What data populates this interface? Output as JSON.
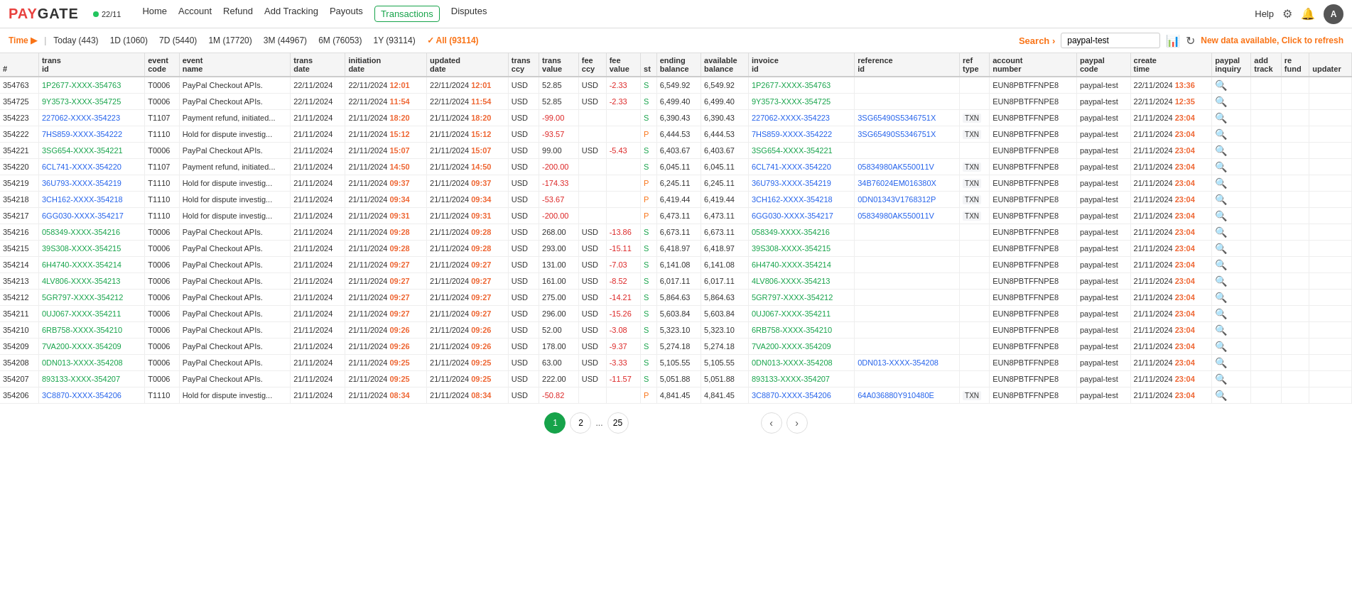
{
  "logo": {
    "text_pay": "PAY",
    "text_gate": "GATE",
    "online_status": "22/11"
  },
  "nav": {
    "links": [
      "Home",
      "Account",
      "Refund",
      "Add Tracking",
      "Payouts",
      "Transactions",
      "Disputes"
    ],
    "active": "Transactions",
    "right": [
      "Help"
    ]
  },
  "filter_bar": {
    "time_label": "Time",
    "arrow": "▶",
    "items": [
      {
        "label": "Today (443)"
      },
      {
        "label": "1D (1060)"
      },
      {
        "label": "7D (5440)"
      },
      {
        "label": "1M (17720)"
      },
      {
        "label": "3M (44967)"
      },
      {
        "label": "6M (76053)"
      },
      {
        "label": "1Y (93114)"
      },
      {
        "label": "✓ All (93114)",
        "active": true
      }
    ],
    "search_label": "Search",
    "search_arrow": "›",
    "search_value": "paypal-test",
    "new_data_msg": "New data available, Click to refresh"
  },
  "table": {
    "columns": [
      {
        "key": "#",
        "label": "#"
      },
      {
        "key": "trans_id",
        "label": "trans\nid"
      },
      {
        "key": "event_code",
        "label": "event\ncode"
      },
      {
        "key": "event_name",
        "label": "event\nname"
      },
      {
        "key": "trans_date",
        "label": "trans\ndate"
      },
      {
        "key": "initiation_date",
        "label": "initiation\ndate"
      },
      {
        "key": "updated_date",
        "label": "updated\ndate"
      },
      {
        "key": "trans_ccy",
        "label": "trans\nccy"
      },
      {
        "key": "trans_value",
        "label": "trans\nvalue"
      },
      {
        "key": "fee_ccy",
        "label": "fee\nccy"
      },
      {
        "key": "fee_value",
        "label": "fee\nvalue"
      },
      {
        "key": "st",
        "label": "st"
      },
      {
        "key": "ending_balance",
        "label": "ending\nbalance"
      },
      {
        "key": "available_balance",
        "label": "available\nbalance"
      },
      {
        "key": "invoice_id",
        "label": "invoice\nid"
      },
      {
        "key": "reference_id",
        "label": "reference\nid"
      },
      {
        "key": "ref_type",
        "label": "ref\ntype"
      },
      {
        "key": "account_number",
        "label": "account\nnumber"
      },
      {
        "key": "paypal_code",
        "label": "paypal\ncode"
      },
      {
        "key": "create_time",
        "label": "create\ntime"
      },
      {
        "key": "paypal_inquiry",
        "label": "paypal\ninquiry"
      },
      {
        "key": "add_track",
        "label": "add\ntrack"
      },
      {
        "key": "re_fund",
        "label": "re\nfund"
      },
      {
        "key": "updater",
        "label": "updater"
      }
    ],
    "rows": [
      {
        "num": "354763",
        "trans_id": "1P2677-XXXX-354763",
        "event_code": "T0006",
        "event_name": "PayPal Checkout APIs.",
        "trans_date": "22/11/2024",
        "initiation_date": "22/11/2024",
        "initiation_time": "12:01",
        "updated_date": "22/11/2024",
        "updated_time": "12:01",
        "trans_ccy": "USD",
        "trans_value": "52.85",
        "fee_ccy": "USD",
        "fee_value": "-2.33",
        "st": "S",
        "ending_balance": "6,549.92",
        "available_balance": "6,549.92",
        "invoice_id": "1P2677-XXXX-354763",
        "reference_id": "",
        "ref_type": "",
        "account_number": "EUN8PBTFFNPE8",
        "paypal_code": "paypal-test",
        "create_date": "22/11/2024",
        "create_time": "13:36"
      },
      {
        "num": "354725",
        "trans_id": "9Y3573-XXXX-354725",
        "event_code": "T0006",
        "event_name": "PayPal Checkout APIs.",
        "trans_date": "22/11/2024",
        "initiation_date": "22/11/2024",
        "initiation_time": "11:54",
        "updated_date": "22/11/2024",
        "updated_time": "11:54",
        "trans_ccy": "USD",
        "trans_value": "52.85",
        "fee_ccy": "USD",
        "fee_value": "-2.33",
        "st": "S",
        "ending_balance": "6,499.40",
        "available_balance": "6,499.40",
        "invoice_id": "9Y3573-XXXX-354725",
        "reference_id": "",
        "ref_type": "",
        "account_number": "EUN8PBTFFNPE8",
        "paypal_code": "paypal-test",
        "create_date": "22/11/2024",
        "create_time": "12:35"
      },
      {
        "num": "354223",
        "trans_id": "227062-XXXX-354223",
        "event_code": "T1107",
        "event_name": "Payment refund, initiated...",
        "trans_date": "21/11/2024",
        "initiation_date": "21/11/2024",
        "initiation_time": "18:20",
        "updated_date": "21/11/2024",
        "updated_time": "18:20",
        "trans_ccy": "USD",
        "trans_value": "-99.00",
        "fee_ccy": "",
        "fee_value": "",
        "st": "S",
        "ending_balance": "6,390.43",
        "available_balance": "6,390.43",
        "invoice_id": "227062-XXXX-354223",
        "reference_id": "3SG65490S5346751X",
        "ref_type": "TXN",
        "account_number": "EUN8PBTFFNPE8",
        "paypal_code": "paypal-test",
        "create_date": "21/11/2024",
        "create_time": "23:04"
      },
      {
        "num": "354222",
        "trans_id": "7HS859-XXXX-354222",
        "event_code": "T1110",
        "event_name": "Hold for dispute investig...",
        "trans_date": "21/11/2024",
        "initiation_date": "21/11/2024",
        "initiation_time": "15:12",
        "updated_date": "21/11/2024",
        "updated_time": "15:12",
        "trans_ccy": "USD",
        "trans_value": "-93.57",
        "fee_ccy": "",
        "fee_value": "",
        "st": "P",
        "ending_balance": "6,444.53",
        "available_balance": "6,444.53",
        "invoice_id": "7HS859-XXXX-354222",
        "reference_id": "3SG65490S5346751X",
        "ref_type": "TXN",
        "account_number": "EUN8PBTFFNPE8",
        "paypal_code": "paypal-test",
        "create_date": "21/11/2024",
        "create_time": "23:04"
      },
      {
        "num": "354221",
        "trans_id": "3SG654-XXXX-354221",
        "event_code": "T0006",
        "event_name": "PayPal Checkout APIs.",
        "trans_date": "21/11/2024",
        "initiation_date": "21/11/2024",
        "initiation_time": "15:07",
        "updated_date": "21/11/2024",
        "updated_time": "15:07",
        "trans_ccy": "USD",
        "trans_value": "99.00",
        "fee_ccy": "USD",
        "fee_value": "-5.43",
        "st": "S",
        "ending_balance": "6,403.67",
        "available_balance": "6,403.67",
        "invoice_id": "3SG654-XXXX-354221",
        "reference_id": "",
        "ref_type": "",
        "account_number": "EUN8PBTFFNPE8",
        "paypal_code": "paypal-test",
        "create_date": "21/11/2024",
        "create_time": "23:04"
      },
      {
        "num": "354220",
        "trans_id": "6CL741-XXXX-354220",
        "event_code": "T1107",
        "event_name": "Payment refund, initiated...",
        "trans_date": "21/11/2024",
        "initiation_date": "21/11/2024",
        "initiation_time": "14:50",
        "updated_date": "21/11/2024",
        "updated_time": "14:50",
        "trans_ccy": "USD",
        "trans_value": "-200.00",
        "fee_ccy": "",
        "fee_value": "",
        "st": "S",
        "ending_balance": "6,045.11",
        "available_balance": "6,045.11",
        "invoice_id": "6CL741-XXXX-354220",
        "reference_id": "05834980AK550011V",
        "ref_type": "TXN",
        "account_number": "EUN8PBTFFNPE8",
        "paypal_code": "paypal-test",
        "create_date": "21/11/2024",
        "create_time": "23:04"
      },
      {
        "num": "354219",
        "trans_id": "36U793-XXXX-354219",
        "event_code": "T1110",
        "event_name": "Hold for dispute investig...",
        "trans_date": "21/11/2024",
        "initiation_date": "21/11/2024",
        "initiation_time": "09:37",
        "updated_date": "21/11/2024",
        "updated_time": "09:37",
        "trans_ccy": "USD",
        "trans_value": "-174.33",
        "fee_ccy": "",
        "fee_value": "",
        "st": "P",
        "ending_balance": "6,245.11",
        "available_balance": "6,245.11",
        "invoice_id": "36U793-XXXX-354219",
        "reference_id": "34B76024EM016380X",
        "ref_type": "TXN",
        "account_number": "EUN8PBTFFNPE8",
        "paypal_code": "paypal-test",
        "create_date": "21/11/2024",
        "create_time": "23:04"
      },
      {
        "num": "354218",
        "trans_id": "3CH162-XXXX-354218",
        "event_code": "T1110",
        "event_name": "Hold for dispute investig...",
        "trans_date": "21/11/2024",
        "initiation_date": "21/11/2024",
        "initiation_time": "09:34",
        "updated_date": "21/11/2024",
        "updated_time": "09:34",
        "trans_ccy": "USD",
        "trans_value": "-53.67",
        "fee_ccy": "",
        "fee_value": "",
        "st": "P",
        "ending_balance": "6,419.44",
        "available_balance": "6,419.44",
        "invoice_id": "3CH162-XXXX-354218",
        "reference_id": "0DN01343V1768312P",
        "ref_type": "TXN",
        "account_number": "EUN8PBTFFNPE8",
        "paypal_code": "paypal-test",
        "create_date": "21/11/2024",
        "create_time": "23:04"
      },
      {
        "num": "354217",
        "trans_id": "6GG030-XXXX-354217",
        "event_code": "T1110",
        "event_name": "Hold for dispute investig...",
        "trans_date": "21/11/2024",
        "initiation_date": "21/11/2024",
        "initiation_time": "09:31",
        "updated_date": "21/11/2024",
        "updated_time": "09:31",
        "trans_ccy": "USD",
        "trans_value": "-200.00",
        "fee_ccy": "",
        "fee_value": "",
        "st": "P",
        "ending_balance": "6,473.11",
        "available_balance": "6,473.11",
        "invoice_id": "6GG030-XXXX-354217",
        "reference_id": "05834980AK550011V",
        "ref_type": "TXN",
        "account_number": "EUN8PBTFFNPE8",
        "paypal_code": "paypal-test",
        "create_date": "21/11/2024",
        "create_time": "23:04"
      },
      {
        "num": "354216",
        "trans_id": "058349-XXXX-354216",
        "event_code": "T0006",
        "event_name": "PayPal Checkout APIs.",
        "trans_date": "21/11/2024",
        "initiation_date": "21/11/2024",
        "initiation_time": "09:28",
        "updated_date": "21/11/2024",
        "updated_time": "09:28",
        "trans_ccy": "USD",
        "trans_value": "268.00",
        "fee_ccy": "USD",
        "fee_value": "-13.86",
        "st": "S",
        "ending_balance": "6,673.11",
        "available_balance": "6,673.11",
        "invoice_id": "058349-XXXX-354216",
        "reference_id": "",
        "ref_type": "",
        "account_number": "EUN8PBTFFNPE8",
        "paypal_code": "paypal-test",
        "create_date": "21/11/2024",
        "create_time": "23:04"
      },
      {
        "num": "354215",
        "trans_id": "39S308-XXXX-354215",
        "event_code": "T0006",
        "event_name": "PayPal Checkout APIs.",
        "trans_date": "21/11/2024",
        "initiation_date": "21/11/2024",
        "initiation_time": "09:28",
        "updated_date": "21/11/2024",
        "updated_time": "09:28",
        "trans_ccy": "USD",
        "trans_value": "293.00",
        "fee_ccy": "USD",
        "fee_value": "-15.11",
        "st": "S",
        "ending_balance": "6,418.97",
        "available_balance": "6,418.97",
        "invoice_id": "39S308-XXXX-354215",
        "reference_id": "",
        "ref_type": "",
        "account_number": "EUN8PBTFFNPE8",
        "paypal_code": "paypal-test",
        "create_date": "21/11/2024",
        "create_time": "23:04"
      },
      {
        "num": "354214",
        "trans_id": "6H4740-XXXX-354214",
        "event_code": "T0006",
        "event_name": "PayPal Checkout APIs.",
        "trans_date": "21/11/2024",
        "initiation_date": "21/11/2024",
        "initiation_time": "09:27",
        "updated_date": "21/11/2024",
        "updated_time": "09:27",
        "trans_ccy": "USD",
        "trans_value": "131.00",
        "fee_ccy": "USD",
        "fee_value": "-7.03",
        "st": "S",
        "ending_balance": "6,141.08",
        "available_balance": "6,141.08",
        "invoice_id": "6H4740-XXXX-354214",
        "reference_id": "",
        "ref_type": "",
        "account_number": "EUN8PBTFFNPE8",
        "paypal_code": "paypal-test",
        "create_date": "21/11/2024",
        "create_time": "23:04"
      },
      {
        "num": "354213",
        "trans_id": "4LV806-XXXX-354213",
        "event_code": "T0006",
        "event_name": "PayPal Checkout APIs.",
        "trans_date": "21/11/2024",
        "initiation_date": "21/11/2024",
        "initiation_time": "09:27",
        "updated_date": "21/11/2024",
        "updated_time": "09:27",
        "trans_ccy": "USD",
        "trans_value": "161.00",
        "fee_ccy": "USD",
        "fee_value": "-8.52",
        "st": "S",
        "ending_balance": "6,017.11",
        "available_balance": "6,017.11",
        "invoice_id": "4LV806-XXXX-354213",
        "reference_id": "",
        "ref_type": "",
        "account_number": "EUN8PBTFFNPE8",
        "paypal_code": "paypal-test",
        "create_date": "21/11/2024",
        "create_time": "23:04"
      },
      {
        "num": "354212",
        "trans_id": "5GR797-XXXX-354212",
        "event_code": "T0006",
        "event_name": "PayPal Checkout APIs.",
        "trans_date": "21/11/2024",
        "initiation_date": "21/11/2024",
        "initiation_time": "09:27",
        "updated_date": "21/11/2024",
        "updated_time": "09:27",
        "trans_ccy": "USD",
        "trans_value": "275.00",
        "fee_ccy": "USD",
        "fee_value": "-14.21",
        "st": "S",
        "ending_balance": "5,864.63",
        "available_balance": "5,864.63",
        "invoice_id": "5GR797-XXXX-354212",
        "reference_id": "",
        "ref_type": "",
        "account_number": "EUN8PBTFFNPE8",
        "paypal_code": "paypal-test",
        "create_date": "21/11/2024",
        "create_time": "23:04"
      },
      {
        "num": "354211",
        "trans_id": "0UJ067-XXXX-354211",
        "event_code": "T0006",
        "event_name": "PayPal Checkout APIs.",
        "trans_date": "21/11/2024",
        "initiation_date": "21/11/2024",
        "initiation_time": "09:27",
        "updated_date": "21/11/2024",
        "updated_time": "09:27",
        "trans_ccy": "USD",
        "trans_value": "296.00",
        "fee_ccy": "USD",
        "fee_value": "-15.26",
        "st": "S",
        "ending_balance": "5,603.84",
        "available_balance": "5,603.84",
        "invoice_id": "0UJ067-XXXX-354211",
        "reference_id": "",
        "ref_type": "",
        "account_number": "EUN8PBTFFNPE8",
        "paypal_code": "paypal-test",
        "create_date": "21/11/2024",
        "create_time": "23:04"
      },
      {
        "num": "354210",
        "trans_id": "6RB758-XXXX-354210",
        "event_code": "T0006",
        "event_name": "PayPal Checkout APIs.",
        "trans_date": "21/11/2024",
        "initiation_date": "21/11/2024",
        "initiation_time": "09:26",
        "updated_date": "21/11/2024",
        "updated_time": "09:26",
        "trans_ccy": "USD",
        "trans_value": "52.00",
        "fee_ccy": "USD",
        "fee_value": "-3.08",
        "st": "S",
        "ending_balance": "5,323.10",
        "available_balance": "5,323.10",
        "invoice_id": "6RB758-XXXX-354210",
        "reference_id": "",
        "ref_type": "",
        "account_number": "EUN8PBTFFNPE8",
        "paypal_code": "paypal-test",
        "create_date": "21/11/2024",
        "create_time": "23:04"
      },
      {
        "num": "354209",
        "trans_id": "7VA200-XXXX-354209",
        "event_code": "T0006",
        "event_name": "PayPal Checkout APIs.",
        "trans_date": "21/11/2024",
        "initiation_date": "21/11/2024",
        "initiation_time": "09:26",
        "updated_date": "21/11/2024",
        "updated_time": "09:26",
        "trans_ccy": "USD",
        "trans_value": "178.00",
        "fee_ccy": "USD",
        "fee_value": "-9.37",
        "st": "S",
        "ending_balance": "5,274.18",
        "available_balance": "5,274.18",
        "invoice_id": "7VA200-XXXX-354209",
        "reference_id": "",
        "ref_type": "",
        "account_number": "EUN8PBTFFNPE8",
        "paypal_code": "paypal-test",
        "create_date": "21/11/2024",
        "create_time": "23:04"
      },
      {
        "num": "354208",
        "trans_id": "0DN013-XXXX-354208",
        "event_code": "T0006",
        "event_name": "PayPal Checkout APIs.",
        "trans_date": "21/11/2024",
        "initiation_date": "21/11/2024",
        "initiation_time": "09:25",
        "updated_date": "21/11/2024",
        "updated_time": "09:25",
        "trans_ccy": "USD",
        "trans_value": "63.00",
        "fee_ccy": "USD",
        "fee_value": "-3.33",
        "st": "S",
        "ending_balance": "5,105.55",
        "available_balance": "5,105.55",
        "invoice_id": "0DN013-XXXX-354208",
        "reference_id": "0DN013-XXXX-354208",
        "ref_type": "",
        "account_number": "EUN8PBTFFNPE8",
        "paypal_code": "paypal-test",
        "create_date": "21/11/2024",
        "create_time": "23:04"
      },
      {
        "num": "354207",
        "trans_id": "893133-XXXX-354207",
        "event_code": "T0006",
        "event_name": "PayPal Checkout APIs.",
        "trans_date": "21/11/2024",
        "initiation_date": "21/11/2024",
        "initiation_time": "09:25",
        "updated_date": "21/11/2024",
        "updated_time": "09:25",
        "trans_ccy": "USD",
        "trans_value": "222.00",
        "fee_ccy": "USD",
        "fee_value": "-11.57",
        "st": "S",
        "ending_balance": "5,051.88",
        "available_balance": "5,051.88",
        "invoice_id": "893133-XXXX-354207",
        "reference_id": "",
        "ref_type": "",
        "account_number": "EUN8PBTFFNPE8",
        "paypal_code": "paypal-test",
        "create_date": "21/11/2024",
        "create_time": "23:04"
      },
      {
        "num": "354206",
        "trans_id": "3C8870-XXXX-354206",
        "event_code": "T1110",
        "event_name": "Hold for dispute investig...",
        "trans_date": "21/11/2024",
        "initiation_date": "21/11/2024",
        "initiation_time": "08:34",
        "updated_date": "21/11/2024",
        "updated_time": "08:34",
        "trans_ccy": "USD",
        "trans_value": "-50.82",
        "fee_ccy": "",
        "fee_value": "",
        "st": "P",
        "ending_balance": "4,841.45",
        "available_balance": "4,841.45",
        "invoice_id": "3C8870-XXXX-354206",
        "reference_id": "64A036880Y910480E",
        "ref_type": "TXN",
        "account_number": "EUN8PBTFFNPE8",
        "paypal_code": "paypal-test",
        "create_date": "21/11/2024",
        "create_time": "23:04"
      }
    ]
  },
  "pagination": {
    "current": 1,
    "pages": [
      "1",
      "2",
      "...",
      "25"
    ],
    "prev_label": "‹",
    "next_label": "›"
  }
}
